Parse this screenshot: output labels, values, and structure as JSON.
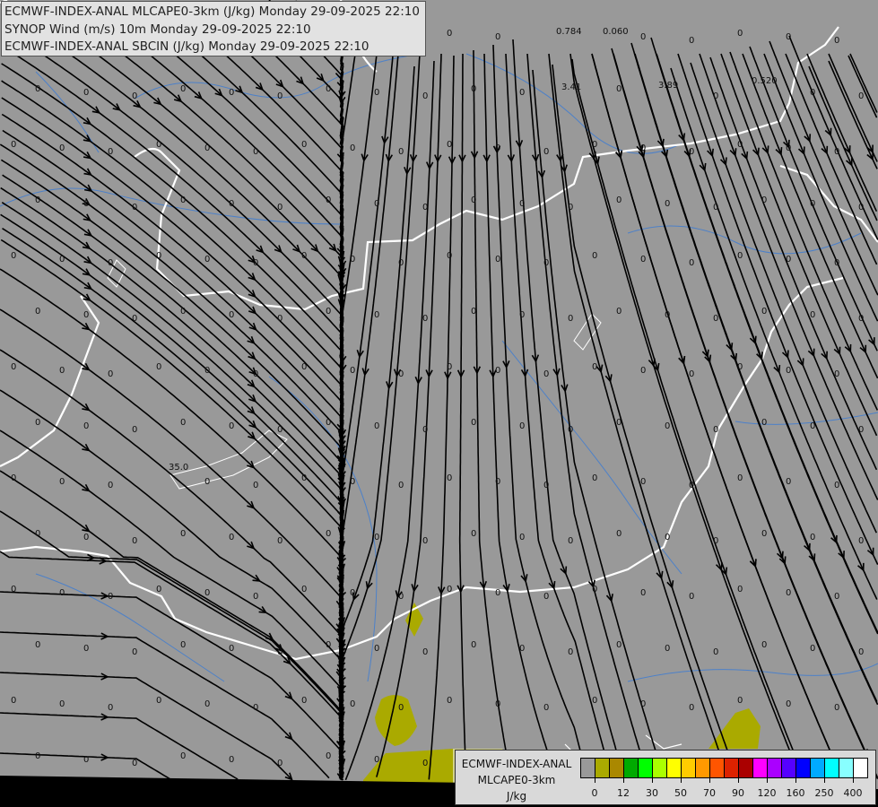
{
  "header": {
    "line1": "ECMWF-INDEX-ANAL MLCAPE0-3km (J/kg) Monday 29-09-2025 22:10",
    "line2": "SYNOP Wind (m/s) 10m Monday 29-09-2025 22:10",
    "line3": "ECMWF-INDEX-ANAL SBCIN (J/kg) Monday 29-09-2025 22:10"
  },
  "legend": {
    "title1": "ECMWF-INDEX-ANAL",
    "title2": "MLCAPE0-3km",
    "unit": "J/kg",
    "colors": [
      "#999999",
      "#aaaa00",
      "#aa8800",
      "#00aa00",
      "#00ff00",
      "#aaff00",
      "#ffff00",
      "#ffcc00",
      "#ff9900",
      "#ff5500",
      "#dd2200",
      "#aa0000",
      "#ff00ff",
      "#aa00ff",
      "#5500ff",
      "#0000ff",
      "#00aaff",
      "#00ffff",
      "#88ffff",
      "#ffffff"
    ],
    "labels": [
      "0",
      "12",
      "30",
      "50",
      "70",
      "90",
      "120",
      "160",
      "250",
      "400"
    ]
  },
  "map": {
    "colors": {
      "background": "#999999",
      "border": "#ffffff",
      "river": "#3a7bd5",
      "cape": "#aaaa00",
      "streamline": "#000000"
    },
    "default_value": "0",
    "special_values": [
      "0.784",
      "0.060",
      "3.41",
      "3.89",
      "0.520",
      "35.0"
    ]
  }
}
